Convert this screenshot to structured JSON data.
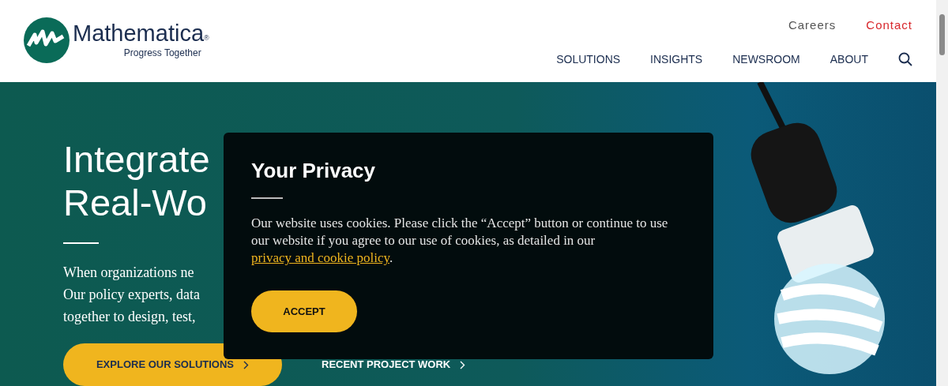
{
  "header": {
    "logo": {
      "name": "Mathematica",
      "registered": "®",
      "tagline": "Progress Together"
    },
    "utility_links": [
      {
        "label": "Careers",
        "kind": "plain"
      },
      {
        "label": "Contact",
        "kind": "accent"
      }
    ],
    "nav": [
      {
        "label": "SOLUTIONS"
      },
      {
        "label": "INSIGHTS"
      },
      {
        "label": "NEWSROOM"
      },
      {
        "label": "ABOUT"
      }
    ]
  },
  "hero": {
    "headline": [
      "Integrate",
      "Real-Wo"
    ],
    "text": [
      "When organizations ne",
      "Our policy experts, data",
      "together to design, test,"
    ],
    "buttons": [
      {
        "label": "EXPLORE OUR SOLUTIONS",
        "kind": "primary"
      },
      {
        "label": "RECENT PROJECT WORK",
        "kind": "link"
      }
    ]
  },
  "privacy_dialog": {
    "title": "Your Privacy",
    "text": "Our website uses cookies. Please click the “Accept” button or continue to use our website if you agree to our use of cookies, as detailed in our",
    "link": "privacy and cookie policy",
    "after_link": ".",
    "button": "ACCEPT"
  }
}
